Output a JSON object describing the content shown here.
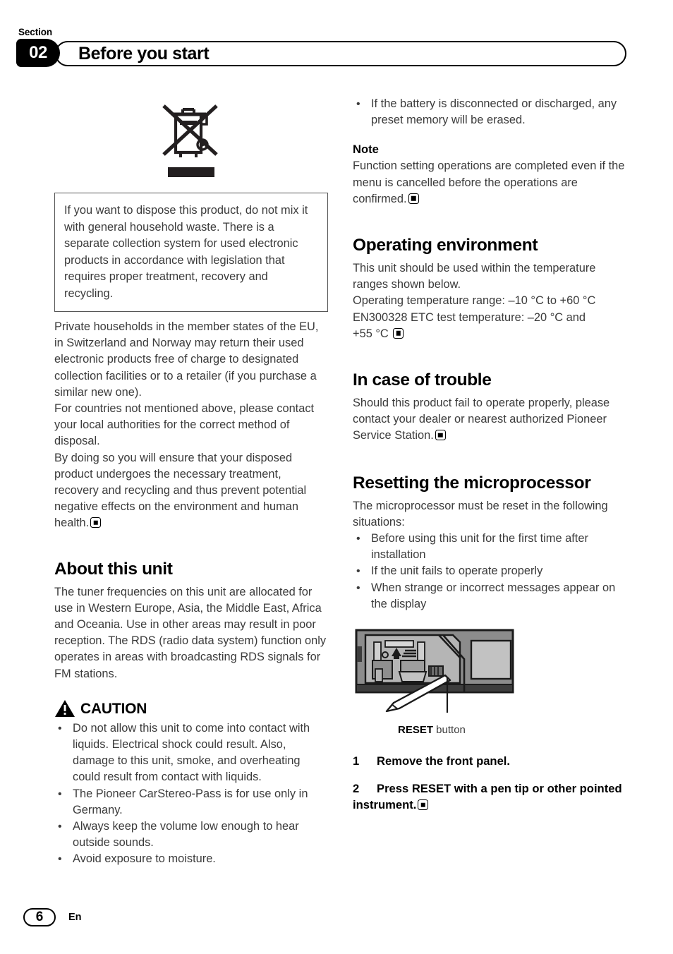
{
  "header": {
    "section_word": "Section",
    "section_number": "02",
    "title": "Before you start"
  },
  "left_column": {
    "weee_icon": "crossed-out-wheeled-bin-icon",
    "dispose_box": {
      "text": "If you want to dispose this product, do not mix it with general household waste. There is a separate collection system for used electronic products in accordance with legislation that requires proper treatment, recovery and recycling."
    },
    "disposal_paragraphs": [
      "Private households in the member states of the EU, in Switzerland and Norway may return their used electronic products free of charge to designated collection facilities or to a retailer (if you purchase a similar new one).",
      "For countries not mentioned above, please contact your local authorities for the correct method of disposal.",
      "By doing so you will ensure that your disposed product undergoes the necessary treatment, recovery and recycling and thus prevent potential negative effects on the environment and human health."
    ],
    "about_unit": {
      "heading": "About this unit",
      "body": "The tuner frequencies on this unit are allocated for use in Western Europe, Asia, the Middle East, Africa and Oceania. Use in other areas may result in poor reception. The RDS (radio data system) function only operates in areas with broadcasting RDS signals for FM stations."
    },
    "caution": {
      "icon": "warning-triangle-icon",
      "label": "CAUTION",
      "items": [
        "Do not allow this unit to come into contact with liquids. Electrical shock could result. Also, damage to this unit, smoke, and overheating could result from contact with liquids.",
        "The Pioneer CarStereo-Pass is for use only in Germany.",
        "Always keep the volume low enough to hear outside sounds.",
        "Avoid exposure to moisture."
      ]
    }
  },
  "right_column": {
    "top_bullets": [
      "If the battery is disconnected or discharged, any preset memory will be erased."
    ],
    "note": {
      "heading": "Note",
      "body": "Function setting operations are completed even if the menu is cancelled before the operations are confirmed."
    },
    "operating_environment": {
      "heading": "Operating environment",
      "line1": "This unit should be used within the temperature ranges shown below.",
      "line2": "Operating temperature range: –10 °C to +60 °C",
      "line3": "EN300328 ETC test temperature: –20 °C and",
      "line4": "+55 °C"
    },
    "in_case_of_trouble": {
      "heading": "In case of trouble",
      "body": "Should this product fail to operate properly, please contact your dealer or nearest authorized Pioneer Service Station."
    },
    "resetting": {
      "heading": "Resetting the microprocessor",
      "intro": "The microprocessor must be reset in the following situations:",
      "bullets": [
        "Before using this unit for the first time after installation",
        "If the unit fails to operate properly",
        "When strange or incorrect messages appear on the display"
      ],
      "figure": {
        "alt": "head-unit-reset-button-diagram",
        "caption_bold": "RESET",
        "caption_rest": " button"
      },
      "steps": [
        {
          "num": "1",
          "text": "Remove the front panel."
        },
        {
          "num": "2",
          "text": "Press RESET with a pen tip or other pointed instrument."
        }
      ]
    }
  },
  "footer": {
    "page_number": "6",
    "language_code": "En"
  }
}
